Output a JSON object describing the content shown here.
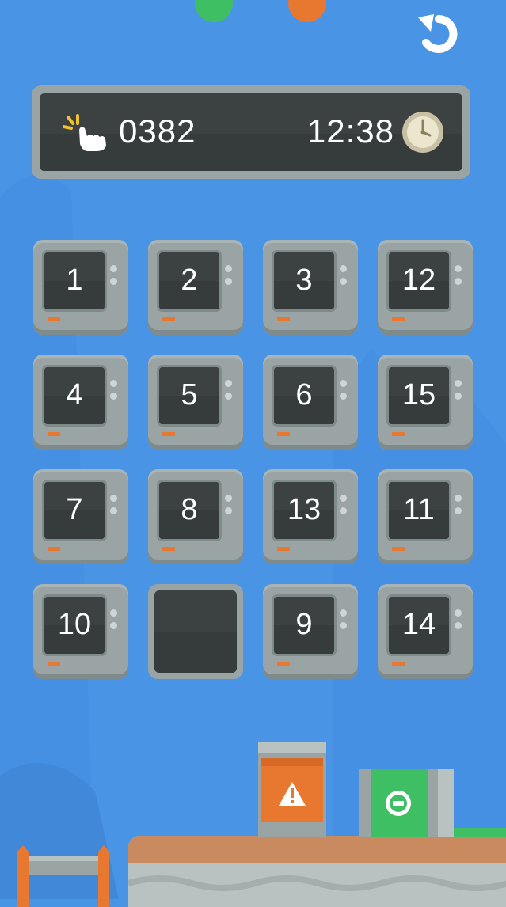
{
  "hud": {
    "moves": "0382",
    "timer": "12:38",
    "tap_icon": "tap-hand-icon",
    "clock_icon": "clock-icon"
  },
  "controls": {
    "undo_icon": "undo-arrow-icon"
  },
  "board": {
    "rows": [
      [
        "1",
        "2",
        "3",
        "12"
      ],
      [
        "4",
        "5",
        "6",
        "15"
      ],
      [
        "7",
        "8",
        "13",
        "11"
      ],
      [
        "10",
        "",
        "9",
        "14"
      ]
    ],
    "empty_position": [
      3,
      1
    ]
  },
  "colors": {
    "background": "#4a94e6",
    "tile_case": "#9aa4a4",
    "screen": "#3c4242",
    "accent_orange": "#e8772f",
    "accent_green": "#3fbf63"
  },
  "scene": {
    "warning_crate_icon": "warning-triangle-icon",
    "green_crate_icon": "minus-circle-icon"
  }
}
